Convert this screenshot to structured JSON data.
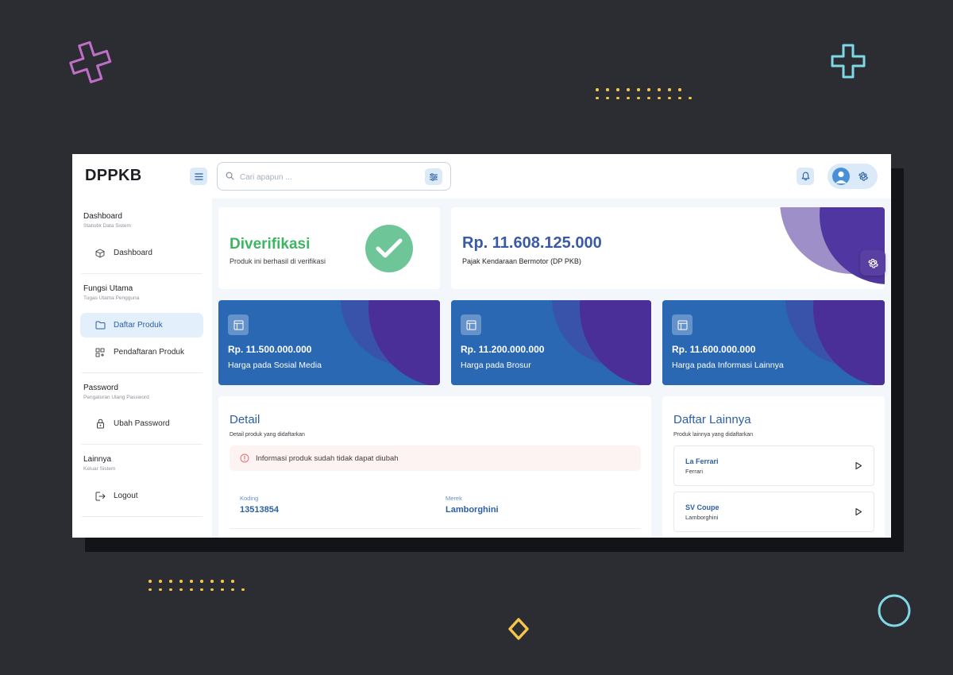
{
  "header": {
    "brand": "DPPKB",
    "search_placeholder": "Cari apapun ..."
  },
  "sidebar": {
    "groups": [
      {
        "title": "Dashboard",
        "subtitle": "Statistik Data Sistem",
        "items": [
          {
            "label": "Dashboard",
            "icon": "cube-icon",
            "active": false
          }
        ]
      },
      {
        "title": "Fungsi Utama",
        "subtitle": "Tugas Utama Pengguna",
        "items": [
          {
            "label": "Daftar Produk",
            "icon": "folder-icon",
            "active": true
          },
          {
            "label": "Pendaftaran Produk",
            "icon": "grid-add-icon",
            "active": false
          }
        ]
      },
      {
        "title": "Password",
        "subtitle": "Pengaturan Ulang Password",
        "items": [
          {
            "label": "Ubah Password",
            "icon": "lock-icon",
            "active": false
          }
        ]
      },
      {
        "title": "Lainnya",
        "subtitle": "Keluar Sistem",
        "items": [
          {
            "label": "Logout",
            "icon": "logout-icon",
            "active": false
          }
        ]
      }
    ]
  },
  "verification": {
    "title": "Diverifikasi",
    "subtitle": "Produk ini berhasil di verifikasi"
  },
  "tax": {
    "amount": "Rp. 11.608.125.000",
    "label": "Pajak Kendaraan Bermotor (DP PKB)"
  },
  "prices": [
    {
      "amount": "Rp. 11.500.000.000",
      "label": "Harga pada Sosial Media"
    },
    {
      "amount": "Rp. 11.200.000.000",
      "label": "Harga pada Brosur"
    },
    {
      "amount": "Rp. 11.600.000.000",
      "label": "Harga pada Informasi Lainnya"
    }
  ],
  "detail": {
    "title": "Detail",
    "subtitle": "Detail produk yang didaftarkan",
    "alert": "Informasi produk sudah tidak dapat diubah",
    "fields": [
      {
        "label": "Koding",
        "value": "13513854"
      },
      {
        "label": "Merek",
        "value": "Lamborghini"
      }
    ]
  },
  "others": {
    "title": "Daftar Lainnya",
    "subtitle": "Produk lainnya yang didaftarkan",
    "items": [
      {
        "name": "La Ferrari",
        "brand": "Ferrari"
      },
      {
        "name": "SV Coupe",
        "brand": "Lamborghini"
      }
    ]
  },
  "colors": {
    "background": "#2b2d33",
    "accent_blue": "#2a68b4",
    "accent_purple": "#5a3fa2",
    "success_green": "#3eb563",
    "dots_yellow": "#f5c64a"
  }
}
